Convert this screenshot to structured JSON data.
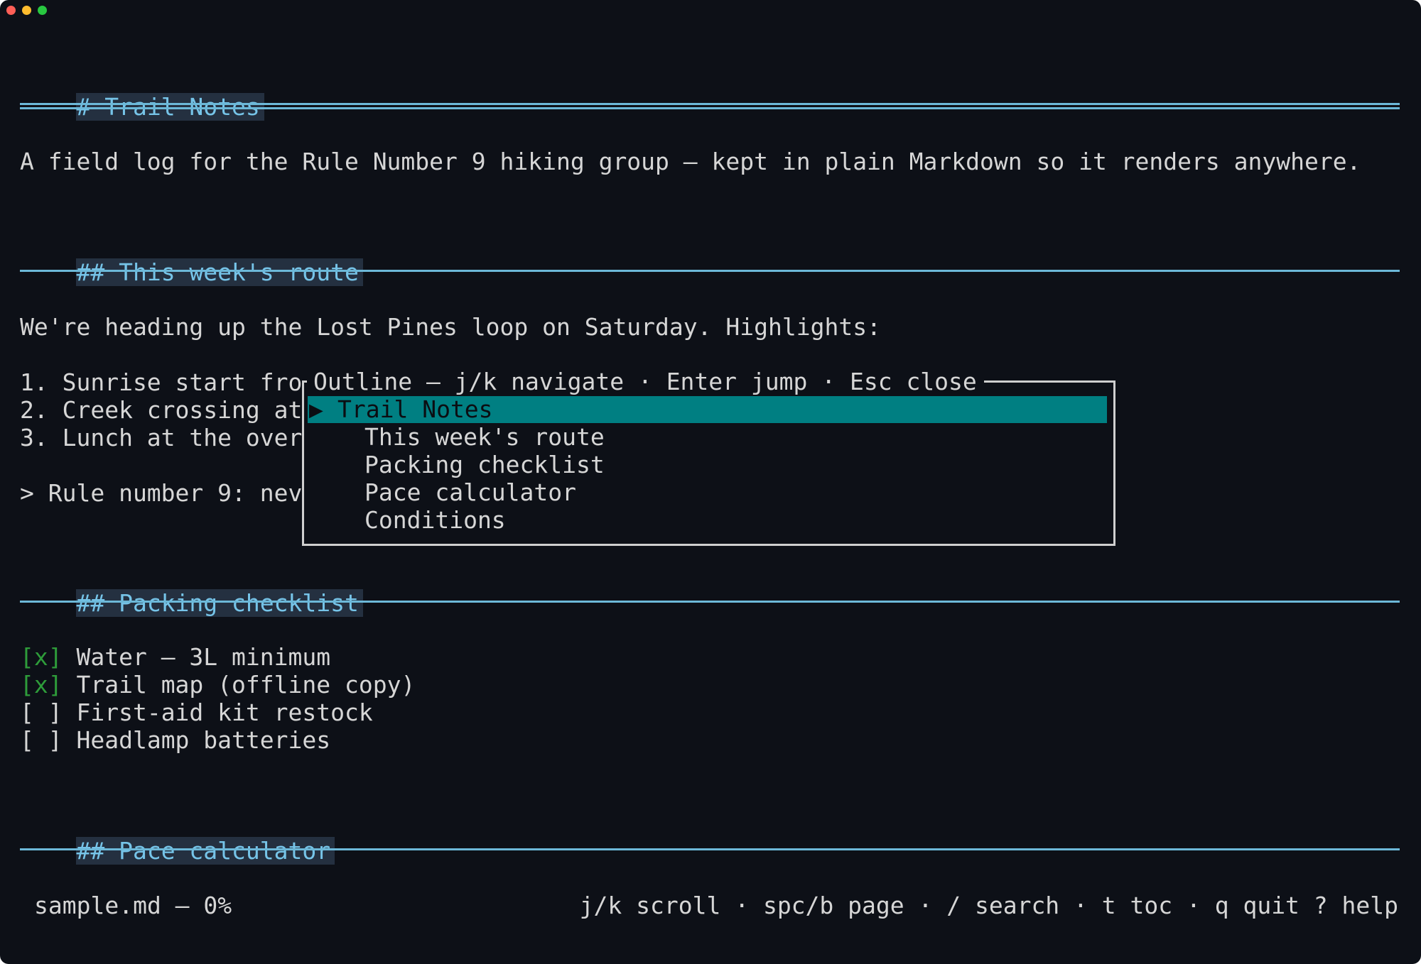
{
  "window": {
    "traffic_lights": [
      "#ff5f57",
      "#febc2e",
      "#28c840"
    ]
  },
  "document": {
    "h1": "# Trail Notes",
    "intro": "A field log for the Rule Number 9 hiking group — kept in plain Markdown so it renders anywhere.",
    "section_route": {
      "heading": "## This week's route",
      "paragraph": "We're heading up the Lost Pines loop on Saturday. Highlights:",
      "list": [
        "1. Sunrise start fro",
        "2. Creek crossing at",
        "3. Lunch at the over"
      ],
      "quote": "> Rule number 9: nev"
    },
    "section_packing": {
      "heading": "## Packing checklist",
      "items": [
        {
          "box": "[x]",
          "text": "Water — 3L minimum"
        },
        {
          "box": "[x]",
          "text": "Trail map (offline copy)"
        },
        {
          "box": "[ ]",
          "text": "First-aid kit restock"
        },
        {
          "box": "[ ]",
          "text": "Headlamp batteries"
        }
      ]
    },
    "section_pace": {
      "heading": "## Pace calculator"
    }
  },
  "outline": {
    "title": "Outline — j/k navigate · Enter jump · Esc close",
    "selected_marker": "▶",
    "items": [
      "Trail Notes",
      "This week's route",
      "Packing checklist",
      "Pace calculator",
      "Conditions"
    ],
    "selected_color": "#007f82"
  },
  "status": {
    "file": "sample.md — 0%",
    "hints": "j/k scroll · spc/b page · / search · t toc · q quit ? help"
  },
  "colors": {
    "background": "#0d1017",
    "heading": "#76c4e8",
    "checked": "#2e9c3a"
  }
}
